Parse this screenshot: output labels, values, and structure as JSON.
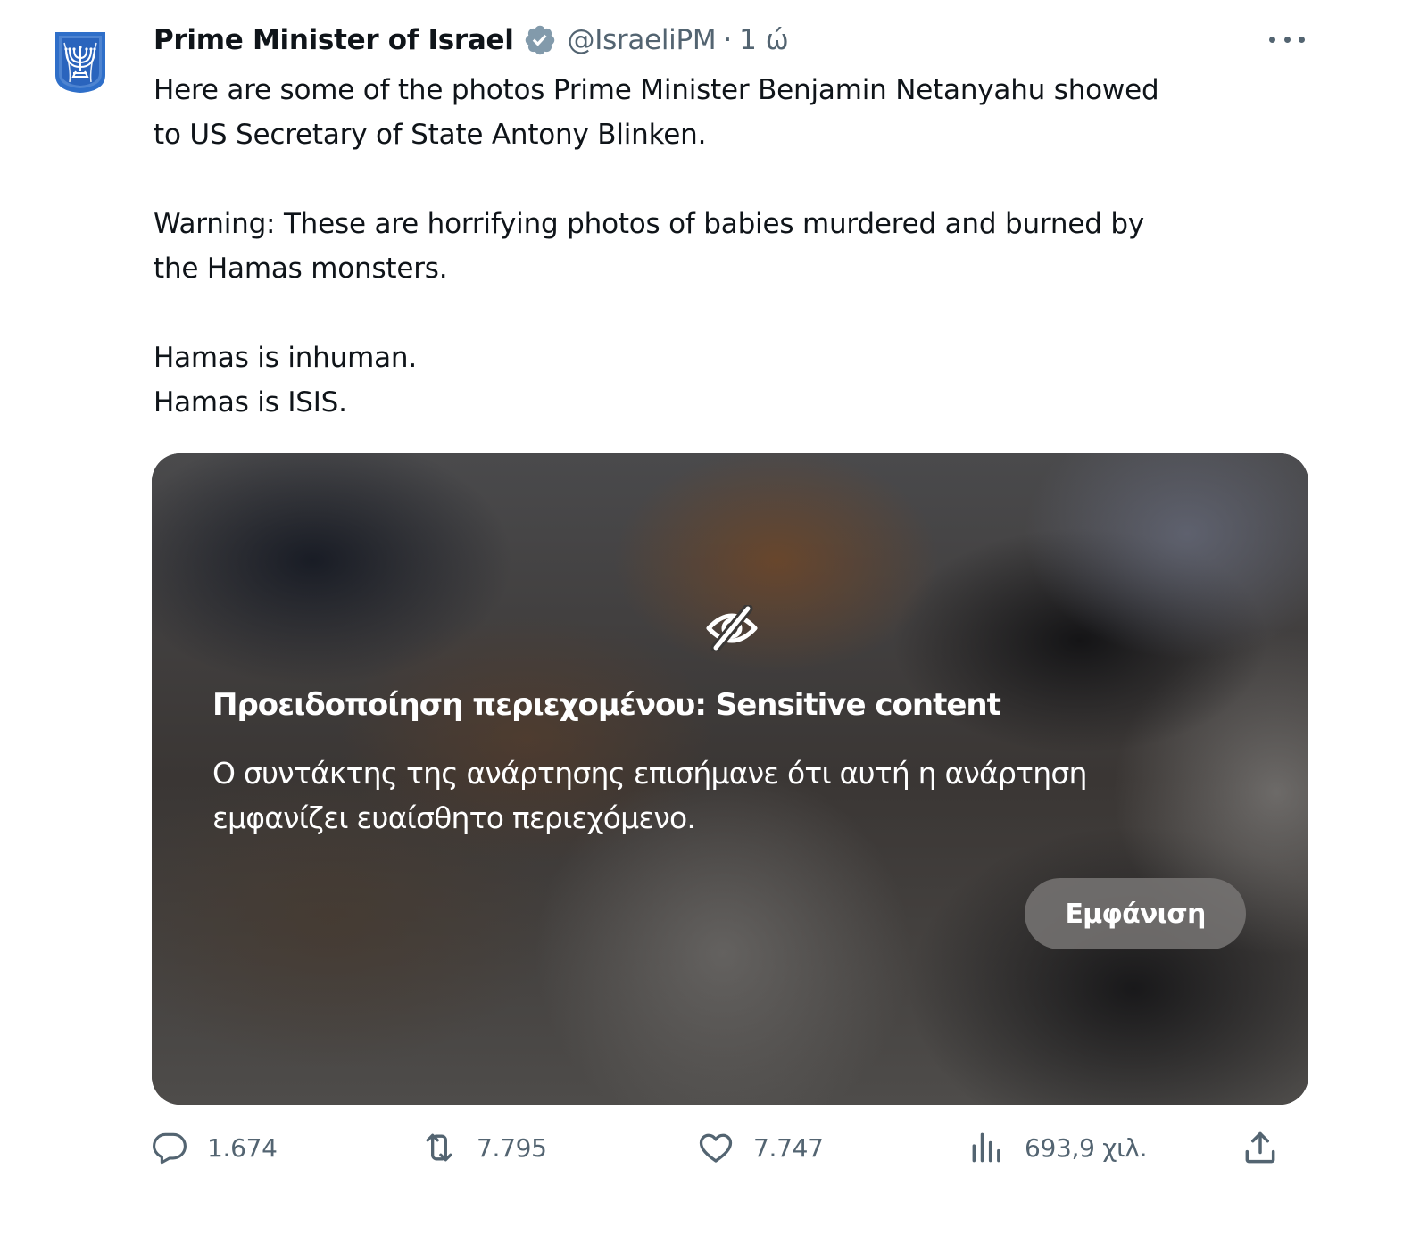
{
  "tweet": {
    "author": {
      "display_name": "Prime Minister of Israel",
      "verified_icon": "verified-badge-icon",
      "handle": "@IsraeliPM",
      "separator": "·",
      "time": "1 ώ"
    },
    "text": {
      "line1": "Here are some of the photos Prime Minister Benjamin Netanyahu showed",
      "line2": "to US Secretary of State Antony Blinken.",
      "line3": "Warning: These are horrifying photos of babies murdered and burned by",
      "line4": "the Hamas monsters.",
      "line5": "Hamas is inhuman.",
      "line6": "Hamas is ISIS."
    },
    "media_warning": {
      "icon": "eye-off-icon",
      "title": "Προειδοποίηση περιεχομένου: Sensitive content",
      "description": "Ο συντάκτης της ανάρτησης επισήμανε ότι αυτή η ανάρτηση εμφανίζει ευαίσθητο περιεχόμενο.",
      "show_button_label": "Εμφάνιση"
    },
    "actions": {
      "replies": "1.674",
      "reposts": "7.795",
      "likes": "7.747",
      "views": "693,9 χιλ."
    }
  },
  "colors": {
    "text_primary": "#0f1419",
    "text_secondary": "#536471",
    "verified_badge": "#829aab",
    "avatar_blue": "#2f6fc9"
  }
}
